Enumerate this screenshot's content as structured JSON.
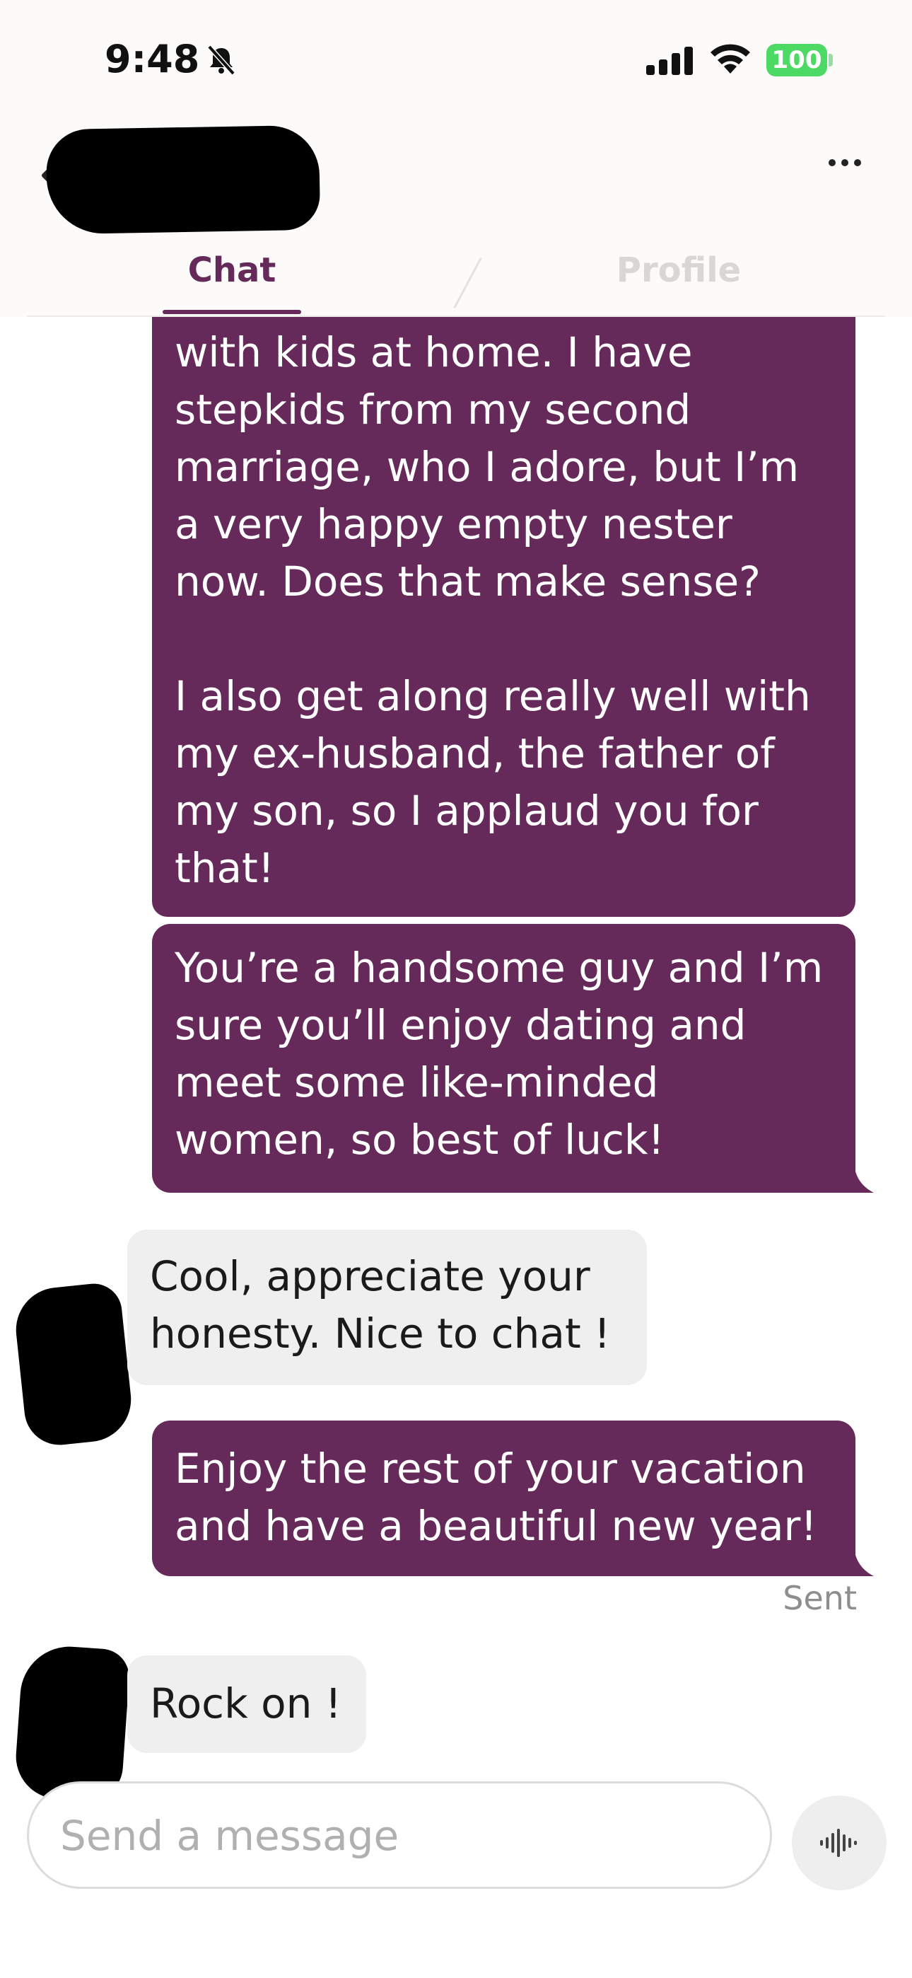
{
  "status_bar": {
    "time": "9:48",
    "battery": "100",
    "icons": [
      "bell-slash-icon",
      "cellular-signal-icon",
      "wifi-icon",
      "battery-icon"
    ],
    "battery_color": "#4cd964"
  },
  "header": {
    "tabs": [
      {
        "label": "Chat",
        "active": true
      },
      {
        "label": "Profile",
        "active": false
      }
    ],
    "accent_color": "#652a5a"
  },
  "messages": [
    {
      "direction": "sent",
      "text": "with kids at home. I have stepkids from my second marriage, who I adore, but I’m a very happy empty nester now. Does that make sense?\n\nI also get along really well with my ex-husband, the father of my son, so I applaud you for that!"
    },
    {
      "direction": "sent",
      "text": "You’re a handsome guy and I’m sure you’ll enjoy dating and meet some like-minded women, so best of luck!"
    },
    {
      "direction": "received",
      "text": "Cool, appreciate your honesty. Nice to chat !"
    },
    {
      "direction": "sent",
      "text": "Enjoy the rest of your vacation and have a beautiful new year!",
      "receipt": "Sent"
    },
    {
      "direction": "received",
      "text": "Rock on !"
    }
  ],
  "composer": {
    "placeholder": "Send a message",
    "value": ""
  }
}
